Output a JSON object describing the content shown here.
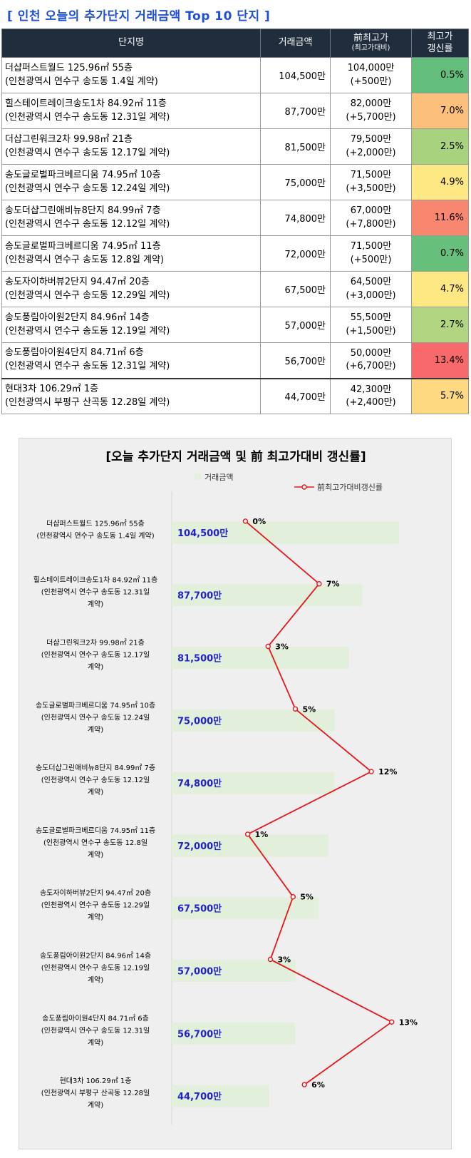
{
  "title": "[ 인천 오늘의 추가단지 거래금액 Top 10 단지 ]",
  "table": {
    "headers": {
      "name": "단지명",
      "price": "거래금액",
      "prev": "前최고가",
      "prev_sub": "(최고가대비)",
      "rate_line1": "최고가",
      "rate_line2": "갱신률"
    },
    "rows": [
      {
        "name": "더샵퍼스트월드 125.96㎡ 55층",
        "addr": "(인천광역시 연수구 송도동 1.4일 계약)",
        "price": "104,500만",
        "prev": "104,000만",
        "diff": "(+500만)",
        "rate": "0.5%",
        "color": "#63be7b"
      },
      {
        "name": "힐스테이트레이크송도1차 84.92㎡ 11층",
        "addr": "(인천광역시 연수구 송도동 12.31일 계약)",
        "price": "87,700만",
        "prev": "82,000만",
        "diff": "(+5,700만)",
        "rate": "7.0%",
        "color": "#fdc07c"
      },
      {
        "name": "더샵그린워크2차 99.98㎡ 21층",
        "addr": "(인천광역시 연수구 송도동 12.17일 계약)",
        "price": "81,500만",
        "prev": "79,500만",
        "diff": "(+2,000만)",
        "rate": "2.5%",
        "color": "#a9d27f"
      },
      {
        "name": "송도글로벌파크베르디움 74.95㎡ 10층",
        "addr": "(인천광역시 연수구 송도동 12.24일 계약)",
        "price": "75,000만",
        "prev": "71,500만",
        "diff": "(+3,500만)",
        "rate": "4.9%",
        "color": "#fee883"
      },
      {
        "name": "송도더샵그린애비뉴8단지 84.99㎡ 7층",
        "addr": "(인천광역시 연수구 송도동 12.12일 계약)",
        "price": "74,800만",
        "prev": "67,000만",
        "diff": "(+7,800만)",
        "rate": "11.6%",
        "color": "#f98770"
      },
      {
        "name": "송도글로벌파크베르디움 74.95㎡ 11층",
        "addr": "(인천광역시 연수구 송도동 12.8일 계약)",
        "price": "72,000만",
        "prev": "71,500만",
        "diff": "(+500만)",
        "rate": "0.7%",
        "color": "#66bf7b"
      },
      {
        "name": "송도자이하버뷰2단지 94.47㎡ 20층",
        "addr": "(인천광역시 연수구 송도동 12.29일 계약)",
        "price": "67,500만",
        "prev": "64,500만",
        "diff": "(+3,000만)",
        "rate": "4.7%",
        "color": "#fde883"
      },
      {
        "name": "송도풍림아이원2단지 84.96㎡ 14층",
        "addr": "(인천광역시 연수구 송도동 12.19일 계약)",
        "price": "57,000만",
        "prev": "55,500만",
        "diff": "(+1,500만)",
        "rate": "2.7%",
        "color": "#b1d580"
      },
      {
        "name": "송도풍림아이원4단지 84.71㎡ 6층",
        "addr": "(인천광역시 연수구 송도동 12.31일 계약)",
        "price": "56,700만",
        "prev": "50,000만",
        "diff": "(+6,700만)",
        "rate": "13.4%",
        "color": "#f8696b"
      },
      {
        "name": "현대3차 106.29㎡ 1층",
        "addr": "(인천광역시 부평구 산곡동 12.28일 계약)",
        "price": "44,700만",
        "prev": "42,300만",
        "diff": "(+2,400만)",
        "rate": "5.7%",
        "color": "#fed981"
      }
    ]
  },
  "chart_data": {
    "type": "bar",
    "orientation": "horizontal",
    "title": "[오늘 추가단지 거래금액 및 前 최고가대비 갱신률]",
    "legend_position": "top",
    "bar_color": "#e2efda",
    "line_color": "#e8161b",
    "value_label_color": "#2222cc",
    "grid": false,
    "xlim": [
      0,
      120000
    ],
    "categories": [
      [
        "더샵퍼스트월드 125.96㎡ 55층",
        "(인천광역시 연수구 송도동 1.4일 계약)"
      ],
      [
        "힐스테이트레이크송도1차 84.92㎡ 11층",
        "(인천광역시 연수구 송도동 12.31일",
        "계약)"
      ],
      [
        "더샵그린워크2차 99.98㎡ 21층",
        "(인천광역시 연수구 송도동 12.17일",
        "계약)"
      ],
      [
        "송도글로벌파크베르디움 74.95㎡ 10층",
        "(인천광역시 연수구 송도동 12.24일",
        "계약)"
      ],
      [
        "송도더샵그린애비뉴8단지 84.99㎡ 7층",
        "(인천광역시 연수구 송도동 12.12일",
        "계약)"
      ],
      [
        "송도글로벌파크베르디움 74.95㎡ 11층",
        "(인천광역시 연수구 송도동 12.8일",
        "계약)"
      ],
      [
        "송도자이하버뷰2단지 94.47㎡ 20층",
        "(인천광역시 연수구 송도동 12.29일",
        "계약)"
      ],
      [
        "송도풍림아이원2단지 84.96㎡ 14층",
        "(인천광역시 연수구 송도동 12.19일",
        "계약)"
      ],
      [
        "송도풍림아이원4단지 84.71㎡ 6층",
        "(인천광역시 연수구 송도동 12.31일",
        "계약)"
      ],
      [
        "현대3차 106.29㎡ 1층",
        "(인천광역시 부평구 산곡동 12.28일",
        "계약)"
      ]
    ],
    "series": [
      {
        "name": "거래금액",
        "kind": "bar",
        "values": [
          104500,
          87700,
          81500,
          75000,
          74800,
          72000,
          67500,
          57000,
          56700,
          44700
        ],
        "labels": [
          "104,500만",
          "87,700만",
          "81,500만",
          "75,000만",
          "74,800만",
          "72,000만",
          "67,500만",
          "57,000만",
          "56,700만",
          "44,700만"
        ]
      },
      {
        "name": "前최고가대비갱신률",
        "kind": "line",
        "values": [
          0.5,
          7.0,
          2.5,
          4.9,
          11.6,
          0.7,
          4.7,
          2.7,
          13.4,
          5.7
        ],
        "labels": [
          "0%",
          "7%",
          "3%",
          "5%",
          "12%",
          "1%",
          "5%",
          "3%",
          "13%",
          "6%"
        ],
        "xlim": [
          -6,
          17
        ]
      }
    ]
  }
}
